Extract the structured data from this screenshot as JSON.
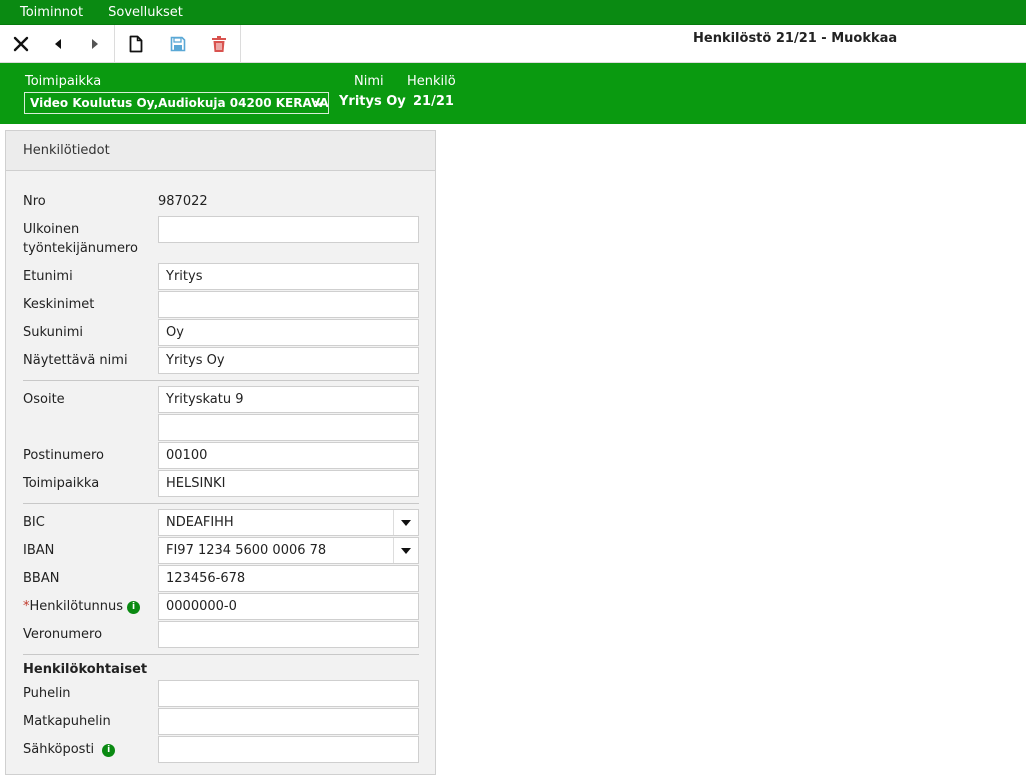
{
  "menubar": {
    "items": [
      "Toiminnot",
      "Sovellukset"
    ]
  },
  "toolbar": {
    "title": "Henkilöstö 21/21 - Muokkaa",
    "buttons": [
      "close-icon",
      "previous-icon",
      "next-icon",
      "new-document-icon",
      "save-icon",
      "delete-icon"
    ],
    "colors": {
      "save": "#5aa8d6",
      "delete": "#d9534f"
    }
  },
  "header": {
    "location_label": "Toimipaikka",
    "location_value": "Video Koulutus Oy,Audiokuja 04200 KERAVA",
    "name_label": "Nimi",
    "name_value": "Yritys Oy",
    "person_label": "Henkilö",
    "person_value": "21/21",
    "background": "#0a9a10"
  },
  "panel": {
    "title": "Henkilötiedot",
    "nro_label": "Nro",
    "nro_value": "987022",
    "external_label_1": "Ulkoinen",
    "external_label_2": "työntekijänumero",
    "external_value": "",
    "first_name_label": "Etunimi",
    "first_name_value": "Yritys",
    "middle_names_label": "Keskinimet",
    "middle_names_value": "",
    "last_name_label": "Sukunimi",
    "last_name_value": "Oy",
    "display_name_label": "Näytettävä nimi",
    "display_name_value": "Yritys Oy",
    "address_label": "Osoite",
    "address_line1": "Yrityskatu 9",
    "address_line2": "",
    "postal_code_label": "Postinumero",
    "postal_code_value": "00100",
    "city_label": "Toimipaikka",
    "city_value": "HELSINKI",
    "bic_label": "BIC",
    "bic_value": "NDEAFIHH",
    "iban_label": "IBAN",
    "iban_value": "FI97 1234 5600 0006 78",
    "bban_label": "BBAN",
    "bban_value": "123456-678",
    "ssn_required_mark": "*",
    "ssn_label": "Henkilötunnus",
    "ssn_value": "0000000-0",
    "tax_number_label": "Veronumero",
    "tax_number_value": "",
    "personal_section": "Henkilökohtaiset",
    "phone_label": "Puhelin",
    "phone_value": "",
    "mobile_label": "Matkapuhelin",
    "mobile_value": "",
    "email_label": "Sähköposti",
    "email_value": ""
  }
}
